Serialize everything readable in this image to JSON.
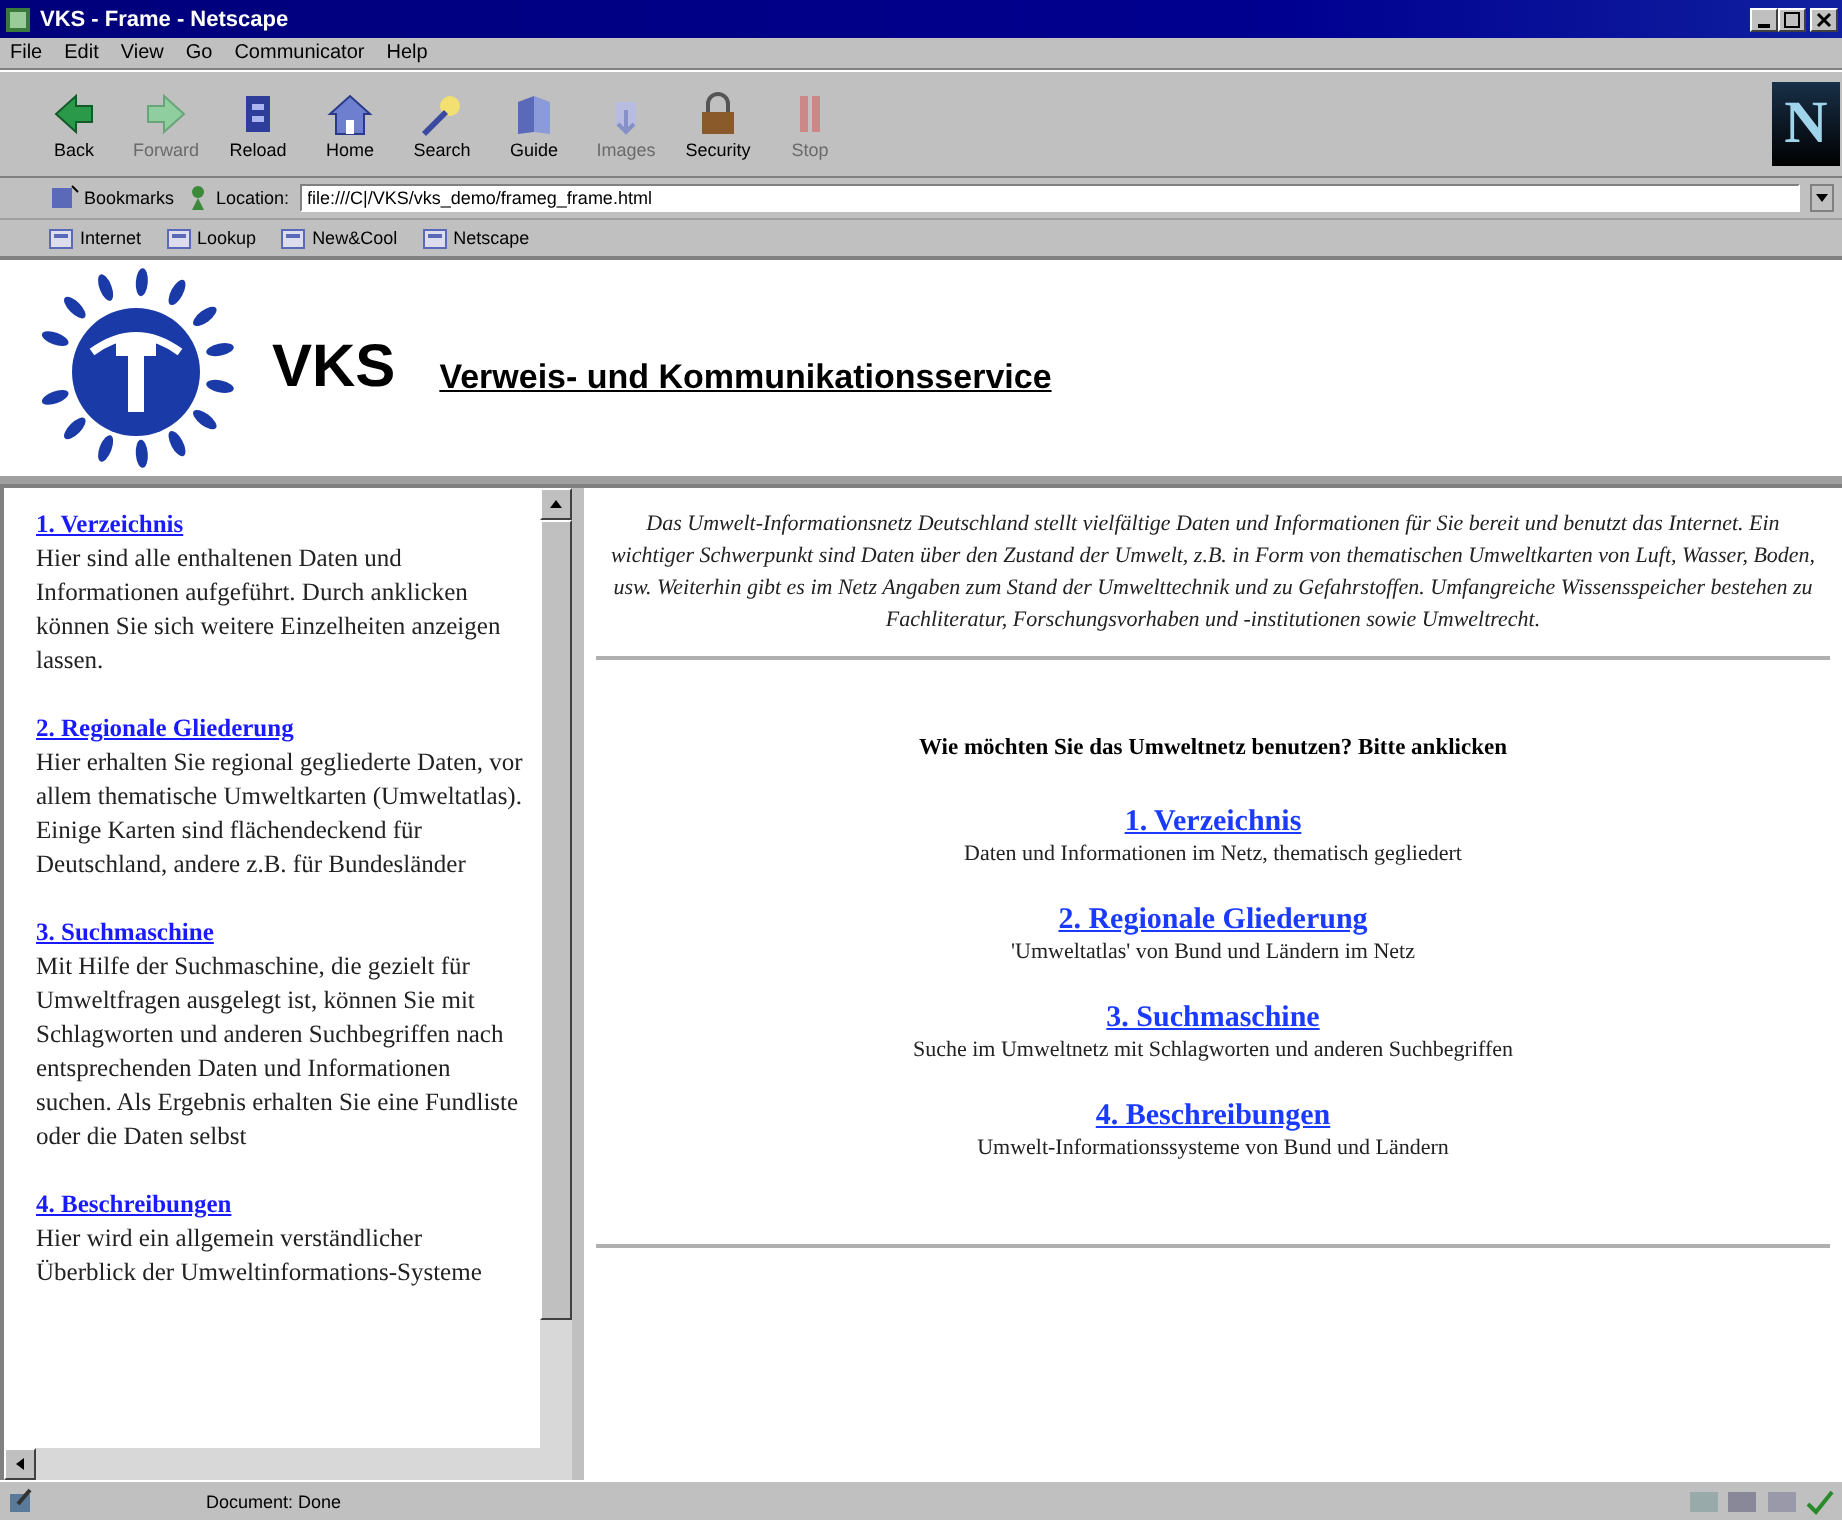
{
  "window": {
    "title": "VKS - Frame - Netscape"
  },
  "menu": [
    "File",
    "Edit",
    "View",
    "Go",
    "Communicator",
    "Help"
  ],
  "toolbar": [
    {
      "kind": "back",
      "label": "Back",
      "disabled": false
    },
    {
      "kind": "forward",
      "label": "Forward",
      "disabled": true
    },
    {
      "kind": "reload",
      "label": "Reload",
      "disabled": false
    },
    {
      "kind": "home",
      "label": "Home",
      "disabled": false
    },
    {
      "kind": "search",
      "label": "Search",
      "disabled": false
    },
    {
      "kind": "guide",
      "label": "Guide",
      "disabled": false
    },
    {
      "kind": "images",
      "label": "Images",
      "disabled": true
    },
    {
      "kind": "security",
      "label": "Security",
      "disabled": false
    },
    {
      "kind": "stop",
      "label": "Stop",
      "disabled": true
    }
  ],
  "logo_letter": "N",
  "location": {
    "bookmarks": "Bookmarks",
    "label": "Location:",
    "value": "file:///C|/VKS/vks_demo/frameg_frame.html"
  },
  "personal_toolbar": [
    "Internet",
    "Lookup",
    "New&Cool",
    "Netscape"
  ],
  "header": {
    "acronym": "VKS",
    "title": "Verweis- und Kommunikationsservice"
  },
  "sidebar": {
    "sections": [
      {
        "link": "1. Verzeichnis",
        "text": "Hier sind alle enthaltenen Daten und Informationen aufgeführt. Durch anklicken können Sie sich weitere Einzelheiten anzeigen lassen."
      },
      {
        "link": "2. Regionale Gliederung",
        "text": "Hier erhalten Sie regional gegliederte Daten, vor allem thematische Umweltkarten (Umweltatlas). Einige Karten sind flächendeckend für Deutschland, andere z.B. für Bundesländer"
      },
      {
        "link": "3. Suchmaschine",
        "text": "Mit Hilfe der Suchmaschine, die gezielt für Umweltfragen ausgelegt ist, können Sie mit Schlagworten und anderen Suchbegriffen nach entsprechenden Daten und Informationen suchen. Als Ergebnis erhalten Sie eine Fundliste oder die Daten selbst"
      },
      {
        "link": "4. Beschreibungen",
        "text": "Hier wird ein allgemein verständlicher Überblick der Umweltinformations-Systeme"
      }
    ]
  },
  "main": {
    "intro": "Das Umwelt-Informationsnetz Deutschland stellt vielfältige Daten und Informationen für Sie bereit und benutzt das Internet. Ein wichtiger Schwerpunkt sind Daten über den Zustand der Umwelt, z.B. in Form von thematischen Umweltkarten von Luft, Wasser, Boden, usw. Weiterhin gibt es im Netz Angaben zum Stand der Umwelttechnik und zu Gefahrstoffen. Umfangreiche Wissensspeicher bestehen zu Fachliteratur, Forschungsvorhaben und -institutionen sowie Umweltrecht.",
    "question": "Wie möchten Sie das Umweltnetz benutzen? Bitte anklicken",
    "links": [
      {
        "label": "1. Verzeichnis",
        "description": "Daten und Informationen im Netz, thematisch gegliedert"
      },
      {
        "label": "2. Regionale Gliederung",
        "description": "'Umweltatlas' von Bund und Ländern im Netz"
      },
      {
        "label": "3. Suchmaschine",
        "description": "Suche im Umweltnetz mit Schlagworten und anderen Suchbegriffen"
      },
      {
        "label": "4. Beschreibungen",
        "description": "Umwelt-Informationssysteme von Bund und Ländern"
      }
    ]
  },
  "status_bar": "Document: Done"
}
